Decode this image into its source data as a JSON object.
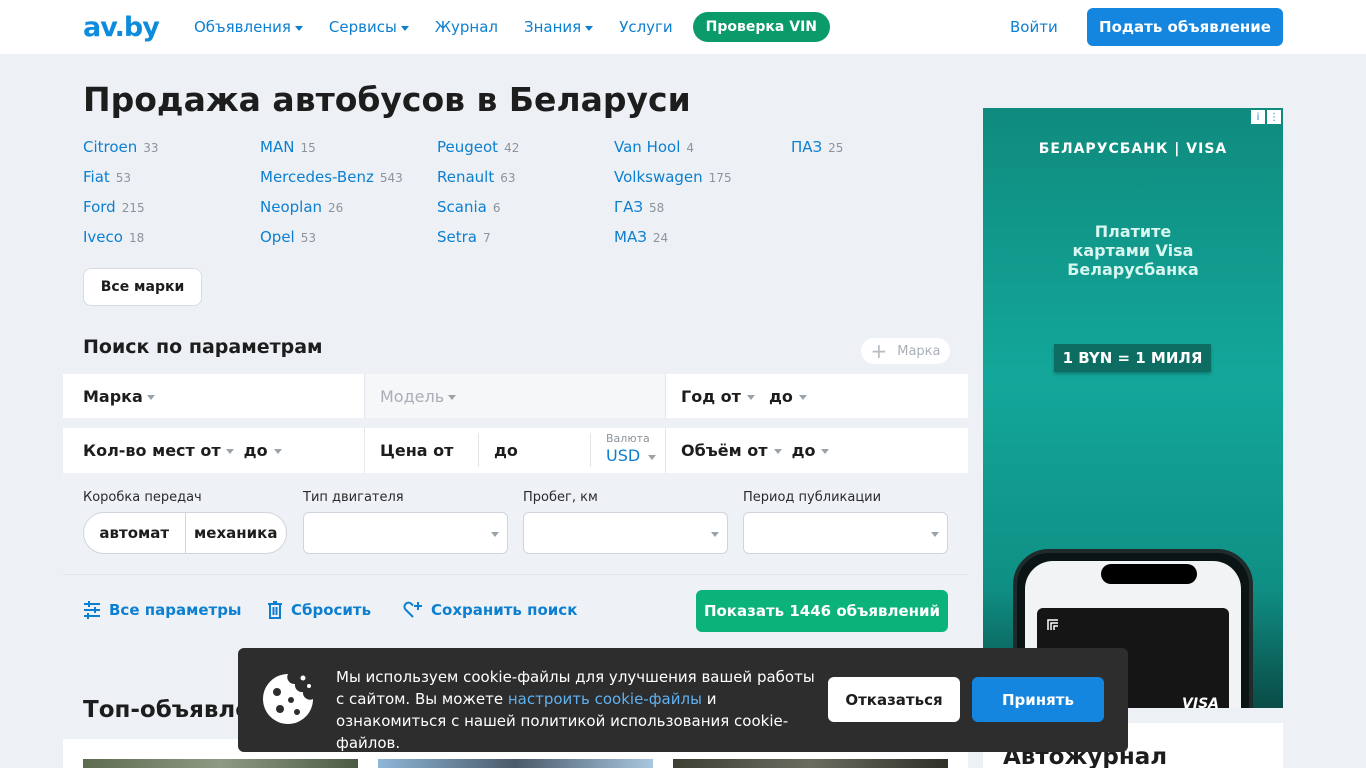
{
  "header": {
    "logo": "av.by",
    "nav": [
      {
        "label": "Объявления",
        "dropdown": true
      },
      {
        "label": "Сервисы",
        "dropdown": true
      },
      {
        "label": "Журнал",
        "dropdown": false
      },
      {
        "label": "Знания",
        "dropdown": true
      },
      {
        "label": "Услуги",
        "dropdown": false
      }
    ],
    "vin_button": "Проверка VIN",
    "login": "Войти",
    "post_button": "Подать объявление"
  },
  "page_title": "Продажа автобусов в Беларуси",
  "brands": [
    [
      {
        "name": "Citroen",
        "count": "33"
      },
      {
        "name": "Fiat",
        "count": "53"
      },
      {
        "name": "Ford",
        "count": "215"
      },
      {
        "name": "Iveco",
        "count": "18"
      }
    ],
    [
      {
        "name": "MAN",
        "count": "15"
      },
      {
        "name": "Mercedes-Benz",
        "count": "543"
      },
      {
        "name": "Neoplan",
        "count": "26"
      },
      {
        "name": "Opel",
        "count": "53"
      }
    ],
    [
      {
        "name": "Peugeot",
        "count": "42"
      },
      {
        "name": "Renault",
        "count": "63"
      },
      {
        "name": "Scania",
        "count": "6"
      },
      {
        "name": "Setra",
        "count": "7"
      }
    ],
    [
      {
        "name": "Van Hool",
        "count": "4"
      },
      {
        "name": "Volkswagen",
        "count": "175"
      },
      {
        "name": "ГАЗ",
        "count": "58"
      },
      {
        "name": "МАЗ",
        "count": "24"
      }
    ],
    [
      {
        "name": "ПАЗ",
        "count": "25"
      }
    ]
  ],
  "all_brands_button": "Все марки",
  "search": {
    "title": "Поиск по параметрам",
    "add_brand": "Марка",
    "brand": "Марка",
    "model": "Модель",
    "year_from": "Год от",
    "year_to": "до",
    "seats_from": "Кол-во мест от",
    "seats_to": "до",
    "price_from": "Цена от",
    "price_to": "до",
    "currency_label": "Валюта",
    "currency_value": "USD",
    "volume_from": "Объём от",
    "volume_to": "до",
    "gearbox_label": "Коробка передач",
    "gearbox_options": [
      "автомат",
      "механика"
    ],
    "engine_label": "Тип двигателя",
    "mileage_label": "Пробег, км",
    "period_label": "Период публикации",
    "all_params": "Все параметры",
    "reset": "Сбросить",
    "save": "Сохранить поиск",
    "show_button": "Показать 1446 объявлений"
  },
  "top_listings_title": "Топ-объявления",
  "journal_title": "Автожурнал",
  "ad": {
    "brand": "БЕЛАРУСБАНК | VISA",
    "text_line1": "Платите",
    "text_line2": "картами Visa",
    "text_line3": "Беларусбанка",
    "pill": "1 BYN = 1 МИЛЯ",
    "card_logo": "VISA"
  },
  "cookie": {
    "text_before": "Мы используем cookie-файлы для улучшения вашей работы с сайтом. Вы можете ",
    "link": "настроить cookie-файлы",
    "text_after": " и ознакомиться с нашей политикой использования cookie-файлов.",
    "decline": "Отказаться",
    "accept": "Принять"
  },
  "colors": {
    "primary_blue": "#1486e0",
    "link_blue": "#0d7fd0",
    "green": "#0bb37b",
    "vin_green": "#0b9b6b",
    "background": "#edf1f5"
  }
}
